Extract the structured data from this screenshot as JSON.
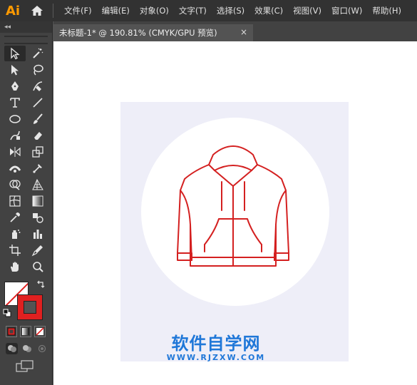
{
  "app": {
    "logo": "Ai",
    "home_icon": "home-icon"
  },
  "menu": {
    "items": [
      {
        "label": "文件(F)"
      },
      {
        "label": "编辑(E)"
      },
      {
        "label": "对象(O)"
      },
      {
        "label": "文字(T)"
      },
      {
        "label": "选择(S)"
      },
      {
        "label": "效果(C)"
      },
      {
        "label": "视图(V)"
      },
      {
        "label": "窗口(W)"
      },
      {
        "label": "帮助(H)"
      }
    ]
  },
  "toolbar": {
    "collapse_label": "◂◂",
    "tools": [
      {
        "icon": "selection-tool-icon",
        "selected": true
      },
      {
        "icon": "magic-wand-icon"
      },
      {
        "icon": "direct-selection-icon"
      },
      {
        "icon": "lasso-icon"
      },
      {
        "icon": "pen-tool-icon"
      },
      {
        "icon": "curvature-tool-icon"
      },
      {
        "icon": "type-tool-icon"
      },
      {
        "icon": "line-segment-icon"
      },
      {
        "icon": "ellipse-tool-icon"
      },
      {
        "icon": "paintbrush-icon"
      },
      {
        "icon": "shaper-tool-icon"
      },
      {
        "icon": "eraser-icon"
      },
      {
        "icon": "reflect-tool-icon"
      },
      {
        "icon": "scale-tool-icon"
      },
      {
        "icon": "width-tool-icon"
      },
      {
        "icon": "puppet-warp-icon"
      },
      {
        "icon": "shape-builder-icon"
      },
      {
        "icon": "perspective-grid-icon"
      },
      {
        "icon": "mesh-tool-icon"
      },
      {
        "icon": "gradient-tool-icon"
      },
      {
        "icon": "eyedropper-icon"
      },
      {
        "icon": "blend-tool-icon"
      },
      {
        "icon": "symbol-sprayer-icon"
      },
      {
        "icon": "column-graph-icon"
      },
      {
        "icon": "artboard-tool-icon"
      },
      {
        "icon": "slice-tool-icon"
      },
      {
        "icon": "hand-tool-icon"
      },
      {
        "icon": "zoom-tool-icon"
      }
    ],
    "fill_color": "#ffffff",
    "stroke_color": "#e02020"
  },
  "document": {
    "tab_title": "未标题-1* @ 190.81% (CMYK/GPU 预览)",
    "close_label": "×"
  },
  "artwork": {
    "stroke_color": "#d42020",
    "artboard_color": "#eeeef8"
  },
  "watermark": {
    "title": "软件自学网",
    "url": "WWW.RJZXW.COM",
    "color": "#1f77d8"
  }
}
